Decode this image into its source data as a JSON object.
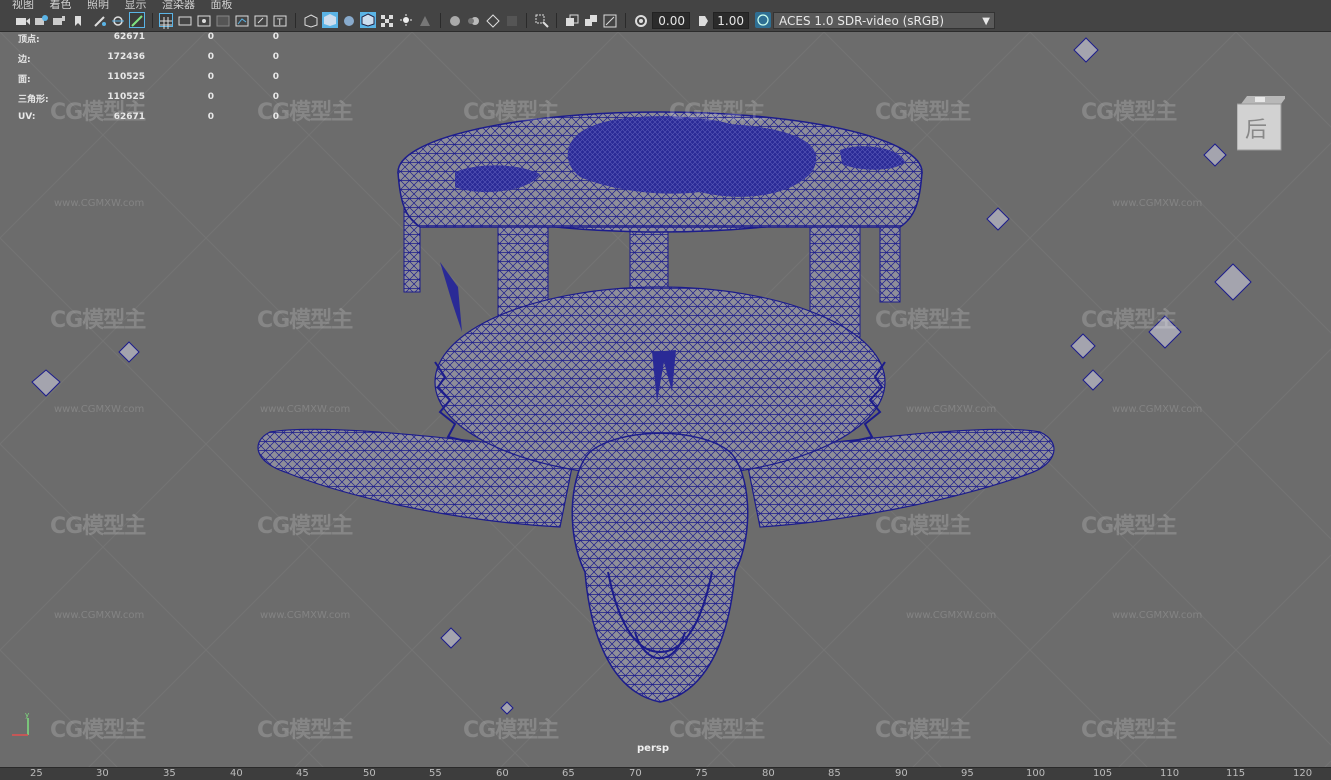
{
  "menubar": {
    "items": [
      "视图",
      "着色",
      "照明",
      "显示",
      "渲染器",
      "面板"
    ]
  },
  "toolbar": {
    "exposure_value": "0.00",
    "gamma_value": "1.00",
    "color_space": "ACES 1.0 SDR-video (sRGB)"
  },
  "hud": {
    "rows": [
      {
        "label": "顶点:",
        "v1": "62671",
        "v2": "0",
        "v3": "0"
      },
      {
        "label": "边:",
        "v1": "172436",
        "v2": "0",
        "v3": "0"
      },
      {
        "label": "面:",
        "v1": "110525",
        "v2": "0",
        "v3": "0"
      },
      {
        "label": "三角形:",
        "v1": "110525",
        "v2": "0",
        "v3": "0"
      },
      {
        "label": "UV:",
        "v1": "62671",
        "v2": "0",
        "v3": "0"
      }
    ]
  },
  "viewport": {
    "camera_label": "persp",
    "viewcube_face": "后",
    "watermark_text": "CG模型主",
    "watermark_url": "www.CGMXW.com"
  },
  "timeline": {
    "ticks": [
      "25",
      "30",
      "35",
      "40",
      "45",
      "50",
      "55",
      "60",
      "65",
      "70",
      "75",
      "80",
      "85",
      "90",
      "95",
      "100",
      "105",
      "110",
      "115",
      "120"
    ]
  },
  "colors": {
    "wire": "#1c1c8c",
    "mesh_fill": "#8c8c96",
    "accent": "#5ab4e6"
  }
}
